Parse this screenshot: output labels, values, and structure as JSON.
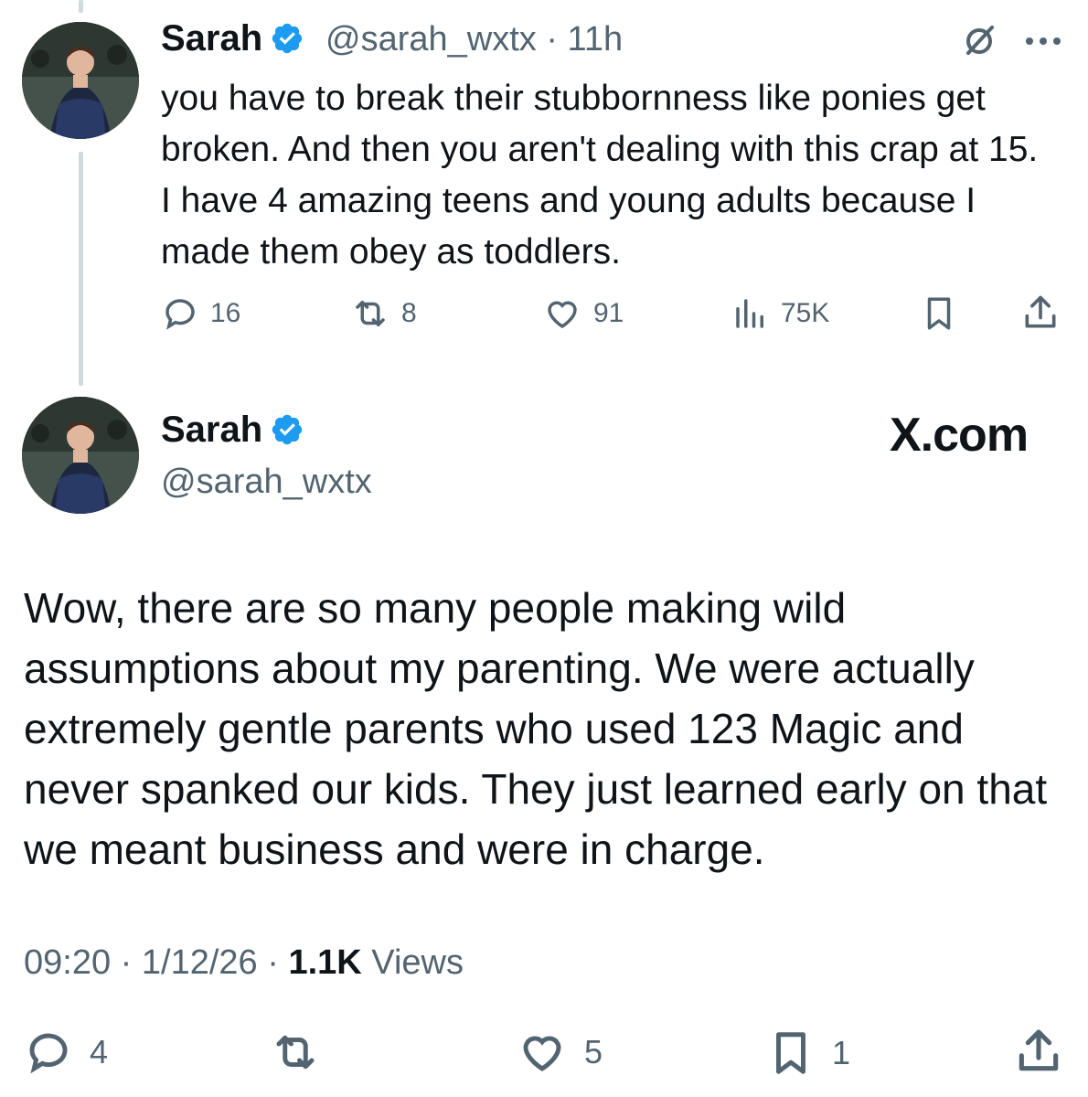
{
  "reply": {
    "author_name": "Sarah",
    "handle": "@sarah_wxtx",
    "separator": "·",
    "time_ago": "11h",
    "text": "you have to break their stubbornness like ponies get broken. And then you aren't dealing with this crap at 15. I have 4 amazing teens and young adults because I made them obey as toddlers.",
    "counts": {
      "replies": "16",
      "reposts": "8",
      "likes": "91",
      "views": "75K"
    },
    "icons": [
      "reply-icon",
      "repost-icon",
      "like-icon",
      "views-icon",
      "bookmark-icon",
      "share-icon",
      "grok-icon",
      "more-icon"
    ]
  },
  "main": {
    "author_name": "Sarah",
    "handle": "@sarah_wxtx",
    "brand": "X.com",
    "text": "Wow, there are so many people making wild assumptions about my parenting. We were actually extremely gentle parents who used 123 Magic and never spanked our kids. They just learned early on that we meant business and were in charge.",
    "time": "09:20",
    "date": "1/12/26",
    "views_count": "1.1K",
    "views_label": "Views",
    "counts": {
      "replies": "4",
      "likes": "5",
      "bookmarks": "1"
    }
  },
  "colors": {
    "verified": "#1d9bf0",
    "muted": "#536471",
    "text": "#0f1419",
    "thread_line": "#cfd9de"
  }
}
